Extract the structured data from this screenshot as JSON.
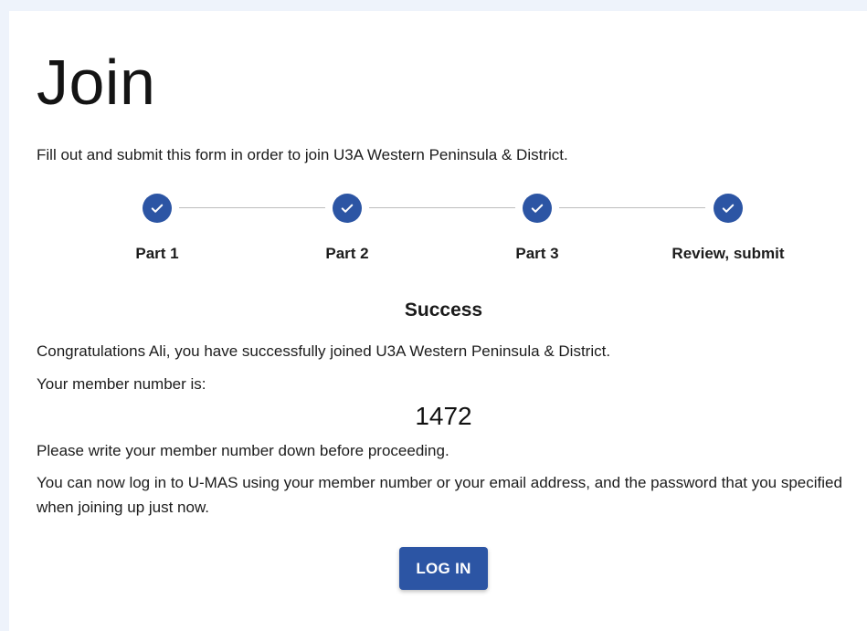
{
  "page": {
    "title": "Join",
    "intro": "Fill out and submit this form in order to join U3A Western Peninsula & District."
  },
  "stepper": {
    "accent_color": "#2c55a4",
    "steps": [
      {
        "label": "Part 1",
        "status": "complete",
        "icon": "check-icon"
      },
      {
        "label": "Part 2",
        "status": "complete",
        "icon": "check-icon"
      },
      {
        "label": "Part 3",
        "status": "complete",
        "icon": "check-icon"
      },
      {
        "label": "Review, submit",
        "status": "complete",
        "icon": "check-icon"
      }
    ]
  },
  "success": {
    "heading": "Success",
    "congrats": "Congratulations Ali, you have successfully joined U3A Western Peninsula & District.",
    "member_number_intro": "Your member number is:",
    "member_number": "1472",
    "write_down": "Please write your member number down before proceeding.",
    "login_info": "You can now log in to U-MAS using your member number or your email address, and the password that you specified when joining up just now.",
    "login_button": "LOG IN"
  }
}
